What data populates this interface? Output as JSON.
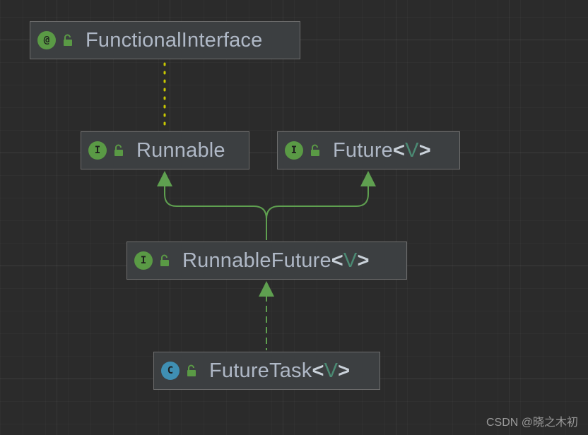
{
  "nodes": {
    "functional_interface": {
      "badge": "@",
      "name": "FunctionalInterface"
    },
    "runnable": {
      "badge": "I",
      "name": "Runnable"
    },
    "future": {
      "badge": "I",
      "name": "Future",
      "lt": "<",
      "type_param": "V",
      "gt": ">"
    },
    "runnable_future": {
      "badge": "I",
      "name": "RunnableFuture",
      "lt": "<",
      "type_param": "V",
      "gt": ">"
    },
    "future_task": {
      "badge": "C",
      "name": "FutureTask",
      "lt": "<",
      "type_param": "V",
      "gt": ">"
    }
  },
  "watermark": "CSDN @晓之木初",
  "colors": {
    "interface_badge": "#5a9a45",
    "class_badge": "#3f8fb3",
    "annotation_link": "#c8c800",
    "inheritance_edge": "#5fa050",
    "node_background": "#3c3f41",
    "type_parameter": "#4b8a73"
  }
}
